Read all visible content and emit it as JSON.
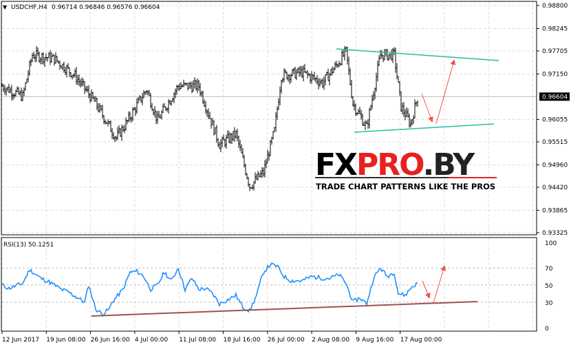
{
  "header": {
    "arrow": "▼",
    "symbol": "USDCHF,H4",
    "ohlc": "0.96714 0.96846 0.96576 0.96604"
  },
  "price_axis": {
    "ticks": [
      "0.98800",
      "0.98245",
      "0.97705",
      "0.97150",
      "0.96604",
      "0.96055",
      "0.95515",
      "0.94960",
      "0.94420",
      "0.93865",
      "0.93325"
    ],
    "tick_values": [
      0.988,
      0.98245,
      0.97705,
      0.9715,
      0.96604,
      0.96055,
      0.95515,
      0.9496,
      0.9442,
      0.93865,
      0.93325
    ],
    "current": "0.96604",
    "current_value": 0.96604,
    "range": [
      0.93325,
      0.988
    ]
  },
  "rsi": {
    "label": "RSI(13) 50.1251",
    "ticks": [
      "100",
      "70",
      "50",
      "30",
      "0"
    ],
    "tick_values": [
      100,
      70,
      50,
      30,
      0
    ]
  },
  "time_axis": {
    "labels": [
      "12 Jun 2017",
      "19 Jun 08:00",
      "26 Jun 16:00",
      "4 Jul 00:00",
      "11 Jul 08:00",
      "18 Jul 16:00",
      "26 Jul 00:00",
      "2 Aug 08:00",
      "9 Aug 16:00",
      "17 Aug 00:00"
    ]
  },
  "logo": {
    "text": "FXPRO.BY",
    "tagline": "TRADE CHART PATTERNS LIKE THE PROS"
  },
  "colors": {
    "teal": "#20c0a0",
    "arrow": "#f05050",
    "rsi": "#1e90ff",
    "support": "#a05050"
  },
  "chart_data": {
    "type": "line",
    "title": "USDCHF,H4",
    "price_path": [
      [
        0,
        0.9686
      ],
      [
        15,
        0.9661
      ],
      [
        22,
        0.9761
      ],
      [
        38,
        0.9752
      ],
      [
        53,
        0.9711
      ],
      [
        68,
        0.9644
      ],
      [
        83,
        0.9561
      ],
      [
        90,
        0.9595
      ],
      [
        105,
        0.9678
      ],
      [
        113,
        0.9603
      ],
      [
        128,
        0.9686
      ],
      [
        143,
        0.9686
      ],
      [
        158,
        0.9545
      ],
      [
        170,
        0.957
      ],
      [
        180,
        0.9445
      ],
      [
        190,
        0.9478
      ],
      [
        198,
        0.9578
      ],
      [
        203,
        0.9711
      ],
      [
        218,
        0.9719
      ],
      [
        233,
        0.9694
      ],
      [
        243,
        0.9736
      ],
      [
        250,
        0.9769
      ],
      [
        255,
        0.9644
      ],
      [
        265,
        0.9586
      ],
      [
        275,
        0.9761
      ],
      [
        285,
        0.9761
      ],
      [
        290,
        0.9636
      ],
      [
        297,
        0.9595
      ],
      [
        302,
        0.966
      ]
    ],
    "rsi_path": [
      [
        0,
        50
      ],
      [
        5,
        46
      ],
      [
        15,
        52
      ],
      [
        20,
        68
      ],
      [
        28,
        58
      ],
      [
        35,
        53
      ],
      [
        43,
        45
      ],
      [
        48,
        42
      ],
      [
        55,
        35
      ],
      [
        60,
        30
      ],
      [
        63,
        50
      ],
      [
        68,
        22
      ],
      [
        73,
        16
      ],
      [
        78,
        22
      ],
      [
        80,
        30
      ],
      [
        88,
        45
      ],
      [
        93,
        65
      ],
      [
        98,
        66
      ],
      [
        103,
        60
      ],
      [
        108,
        45
      ],
      [
        113,
        50
      ],
      [
        118,
        65
      ],
      [
        123,
        55
      ],
      [
        128,
        70
      ],
      [
        133,
        45
      ],
      [
        138,
        58
      ],
      [
        143,
        45
      ],
      [
        148,
        46
      ],
      [
        153,
        40
      ],
      [
        158,
        28
      ],
      [
        163,
        32
      ],
      [
        170,
        38
      ],
      [
        175,
        24
      ],
      [
        180,
        20
      ],
      [
        185,
        38
      ],
      [
        188,
        55
      ],
      [
        190,
        65
      ],
      [
        195,
        74
      ],
      [
        200,
        72
      ],
      [
        205,
        60
      ],
      [
        210,
        55
      ],
      [
        218,
        55
      ],
      [
        225,
        60
      ],
      [
        233,
        58
      ],
      [
        238,
        58
      ],
      [
        245,
        62
      ],
      [
        250,
        52
      ],
      [
        255,
        30
      ],
      [
        260,
        35
      ],
      [
        265,
        28
      ],
      [
        270,
        58
      ],
      [
        275,
        70
      ],
      [
        280,
        60
      ],
      [
        285,
        65
      ],
      [
        288,
        40
      ],
      [
        293,
        38
      ],
      [
        298,
        48
      ],
      [
        302,
        52
      ]
    ],
    "ylim": [
      0.93325,
      0.988
    ],
    "rsi_ylim": [
      0,
      100
    ]
  }
}
